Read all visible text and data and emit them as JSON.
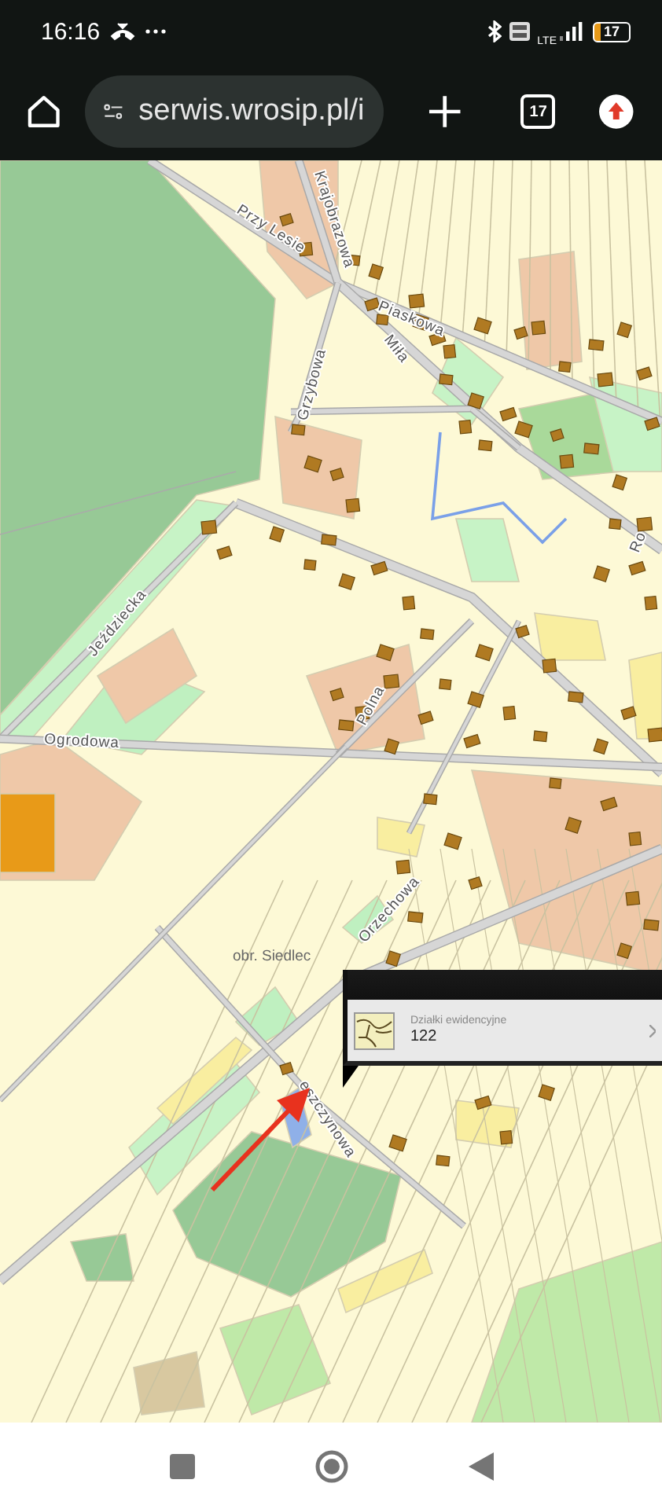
{
  "status_bar": {
    "time": "16:16",
    "network": "LTE",
    "battery": "17"
  },
  "browser": {
    "url": "serwis.wrosip.pl/i",
    "tab_count": "17"
  },
  "map": {
    "labels": [
      {
        "text": "Przy Lesie",
        "kind": "street"
      },
      {
        "text": "Krajobrazowa",
        "kind": "street"
      },
      {
        "text": "Grzybowa",
        "kind": "street"
      },
      {
        "text": "Piaskowa",
        "kind": "street"
      },
      {
        "text": "Miła",
        "kind": "street"
      },
      {
        "text": "Ro",
        "kind": "street"
      },
      {
        "text": "Jeździecka",
        "kind": "street"
      },
      {
        "text": "Ogrodowa",
        "kind": "street"
      },
      {
        "text": "Polna",
        "kind": "street"
      },
      {
        "text": "Orzechowa",
        "kind": "street"
      },
      {
        "text": "eszczynowa",
        "kind": "street"
      },
      {
        "text": "obr. Siedlec",
        "kind": "district"
      }
    ]
  },
  "popup": {
    "layer": "Działki ewidencyjne",
    "value": "122"
  }
}
